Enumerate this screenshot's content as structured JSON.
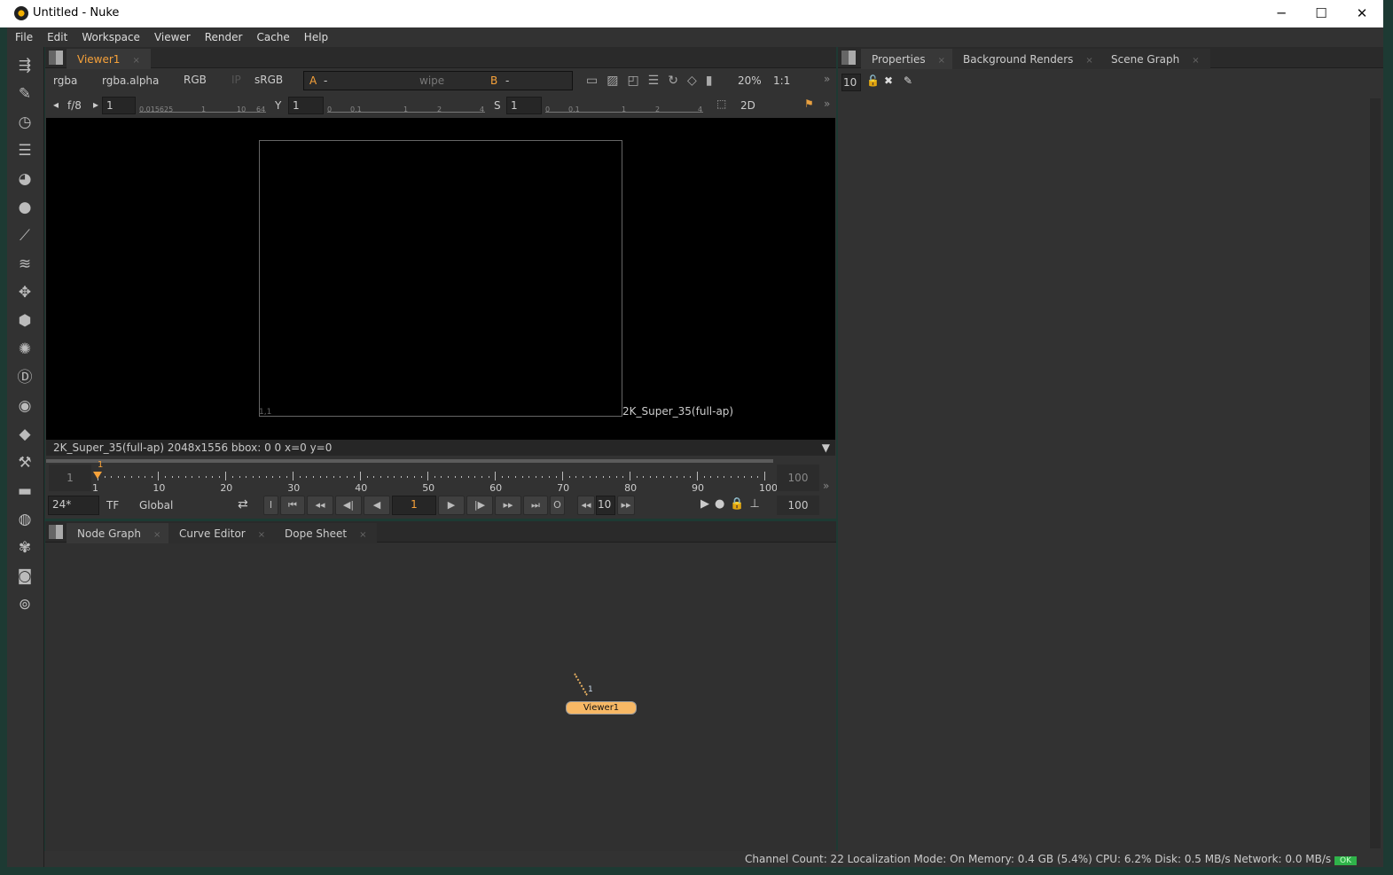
{
  "window": {
    "title": "Untitled - Nuke",
    "minimize": "─",
    "maximize": "☐",
    "close": "✕"
  },
  "menu": [
    "File",
    "Edit",
    "Workspace",
    "Viewer",
    "Render",
    "Cache",
    "Help"
  ],
  "left_toolbar_icons": [
    "image-icon",
    "draw-icon",
    "time-icon",
    "channel-icon",
    "color-icon",
    "filter-icon",
    "keyer-icon",
    "merge-icon",
    "transform-icon",
    "3d-icon",
    "particles-icon",
    "deep-icon",
    "views-icon",
    "metadata-icon",
    "toolsets-icon",
    "other-icon",
    "furnace-icon",
    "cara-icon",
    "ofx-icon",
    "bokeh-icon"
  ],
  "viewer": {
    "tab": "Viewer1",
    "tab_close": "×",
    "channels": "rgba",
    "alpha": "rgba.alpha",
    "display": "RGB",
    "ip": "IP",
    "lut": "sRGB",
    "input_a_label": "A",
    "input_a": "-",
    "wipe": "wipe",
    "input_b_label": "B",
    "input_b": "-",
    "zoom": "20%",
    "ratio": "1:1",
    "fstop": "f/8",
    "gain": "1",
    "gain_ticks": [
      "0.015625",
      "1",
      "10",
      "64"
    ],
    "gamma_label": "Y",
    "gamma": "1",
    "gamma_ticks": [
      "0",
      "0.1",
      "1",
      "2",
      "4"
    ],
    "sat_label": "S",
    "sat": "1",
    "sat_ticks": [
      "0",
      "0.1",
      "1",
      "2",
      "4"
    ],
    "view_mode": "2D",
    "format_label": "2K_Super_35(full-ap)",
    "origin_label": "1,1",
    "info": "2K_Super_35(full-ap) 2048x1556  bbox: 0 0   x=0 y=0"
  },
  "timeline": {
    "start": "1",
    "end": "100",
    "current": "1",
    "ticks": [
      "1",
      "10",
      "20",
      "30",
      "40",
      "50",
      "60",
      "70",
      "80",
      "90",
      "100"
    ],
    "fps": "24*",
    "tf": "TF",
    "range": "Global",
    "increment": "10",
    "end_frame": "100",
    "in_btn": "I",
    "out_btn": "O"
  },
  "bottom_tabs": [
    {
      "label": "Node Graph"
    },
    {
      "label": "Curve Editor"
    },
    {
      "label": "Dope Sheet"
    }
  ],
  "node": {
    "label": "Viewer1",
    "input": "1",
    "color": "#f7b865"
  },
  "right_tabs": [
    {
      "label": "Properties"
    },
    {
      "label": "Background Renders"
    },
    {
      "label": "Scene Graph"
    }
  ],
  "properties": {
    "max_panels": "10"
  },
  "status": {
    "text": "Channel Count: 22  Localization Mode: On  Memory: 0.4 GB (5.4%)  CPU: 6.2%  Disk: 0.5 MB/s  Network: 0.0 MB/s",
    "ok": "OK"
  },
  "colors": {
    "accent": "#f7a23a",
    "bg": "#323232",
    "ok": "#2fb34a"
  }
}
